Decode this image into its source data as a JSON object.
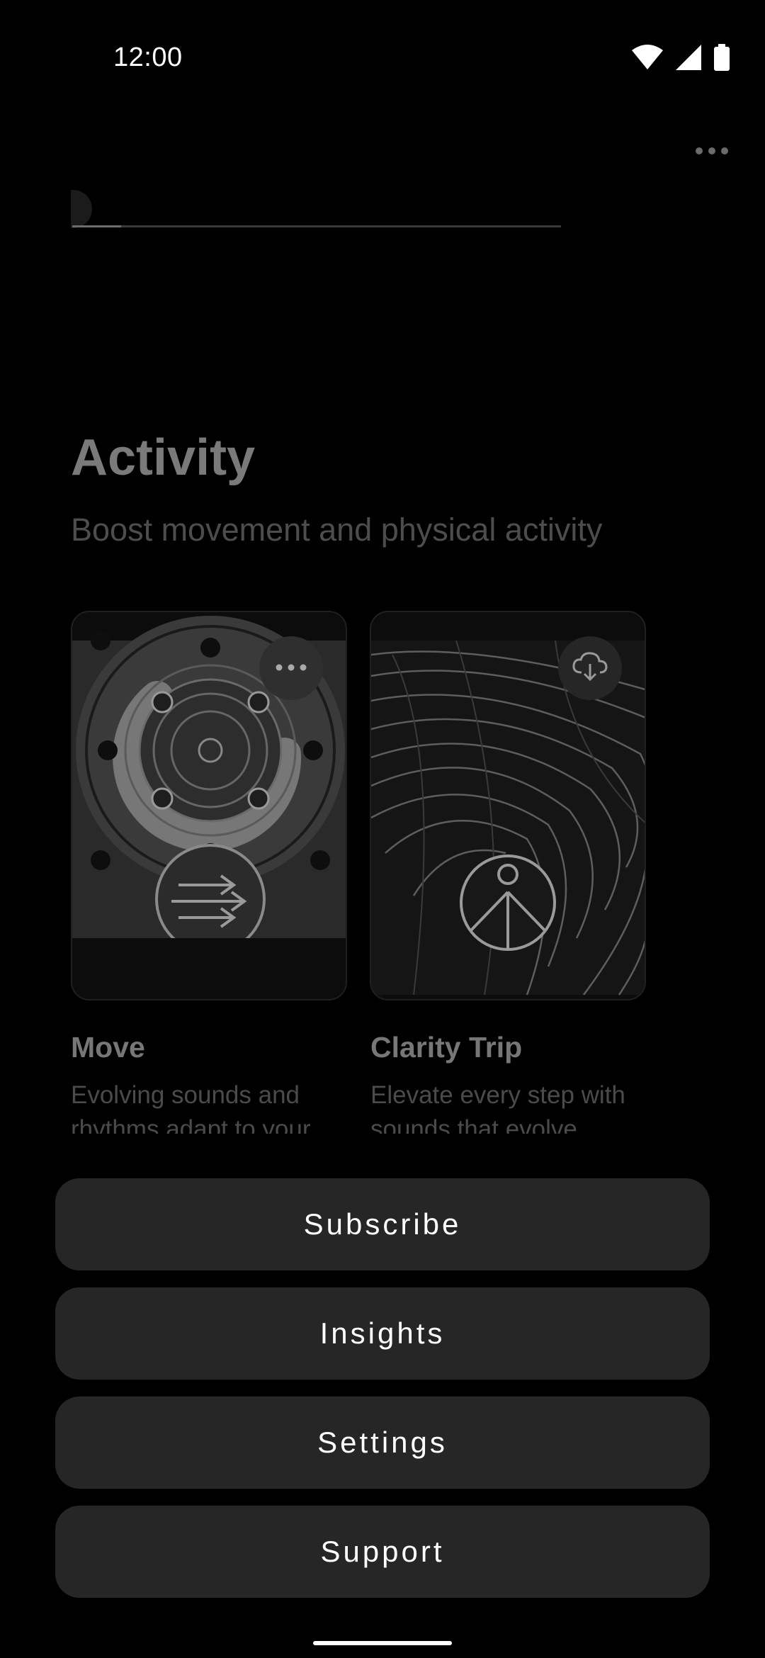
{
  "status_bar": {
    "time": "12:00",
    "icons": [
      "wifi-icon",
      "cell-signal-icon",
      "battery-icon"
    ]
  },
  "background": {
    "more_icon": "more-horizontal-icon",
    "player_progress": 0.1,
    "section": {
      "title": "Activity",
      "subtitle": "Boost movement and physical activity"
    },
    "cards": [
      {
        "title": "Move",
        "description": "Evolving sounds and rhythms adapt to your",
        "badge_icon": "more-horizontal-icon"
      },
      {
        "title": "Clarity Trip",
        "description": "Elevate every step with sounds that evolve",
        "badge_icon": "cloud-download-icon"
      }
    ]
  },
  "menu": {
    "subscribe": "Subscribe",
    "insights": "Insights",
    "settings": "Settings",
    "support": "Support"
  },
  "colors": {
    "background": "#000000",
    "button": "#262626",
    "button_text": "#ffffff"
  }
}
